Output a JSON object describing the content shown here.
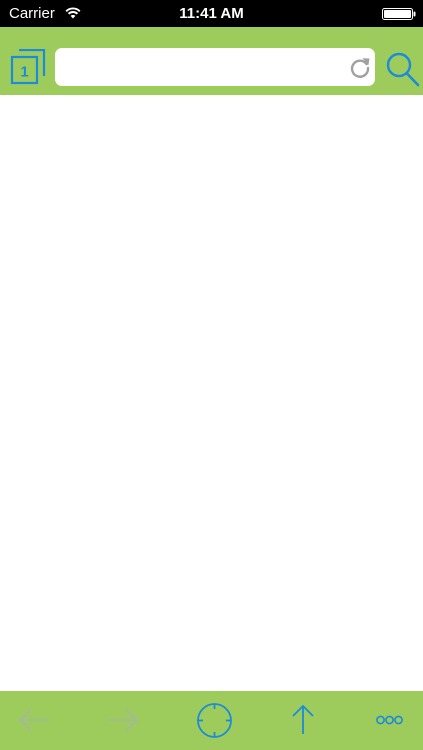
{
  "status_bar": {
    "carrier": "Carrier",
    "time": "11:41 AM",
    "icons": [
      "wifi-icon",
      "battery-icon"
    ]
  },
  "toolbar": {
    "tab_count": "1",
    "url": {
      "value": "",
      "placeholder": ""
    },
    "icons": [
      "tabs-icon",
      "reload-icon",
      "search-icon"
    ]
  },
  "bottom_toolbar": {
    "icons": [
      "back-arrow-icon",
      "forward-arrow-icon",
      "compass-icon",
      "share-icon",
      "more-icon"
    ],
    "back_enabled": false,
    "forward_enabled": false
  },
  "colors": {
    "toolbar_green": "#9dcc5c",
    "accent_blue": "#1a8cd8",
    "disabled_gray": "#a5b5a8",
    "status_bar_black": "#000000"
  }
}
